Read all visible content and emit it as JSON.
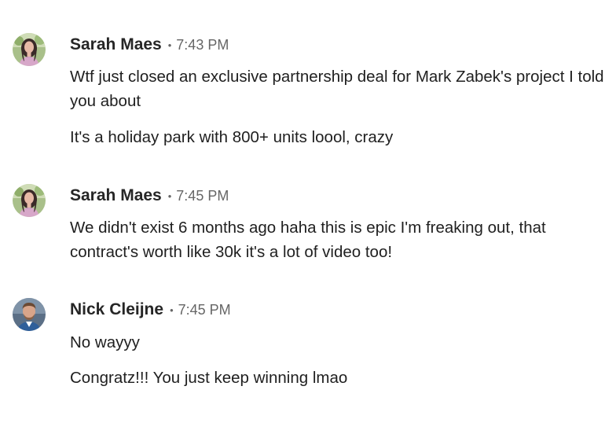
{
  "messages": [
    {
      "sender": "Sarah Maes",
      "separator": "•",
      "time": "7:43 PM",
      "avatar_icon": "avatar-woman-photo",
      "lines": [
        "Wtf just closed an exclusive partnership deal for Mark Zabek's project I told you about",
        "It's a holiday park with 800+ units loool, crazy"
      ]
    },
    {
      "sender": "Sarah Maes",
      "separator": "•",
      "time": "7:45 PM",
      "avatar_icon": "avatar-woman-photo",
      "lines": [
        "We didn't exist 6 months ago haha this is epic I'm freaking out, that contract's worth like 30k it's a lot of video too!"
      ]
    },
    {
      "sender": "Nick Cleijne",
      "separator": "•",
      "time": "7:45 PM",
      "avatar_icon": "avatar-man-photo",
      "lines": [
        "No wayyy",
        "Congratz!!! You just keep winning lmao"
      ]
    }
  ],
  "colors": {
    "sender": "#262626",
    "meta": "#666666",
    "text": "#1f1f1f"
  }
}
